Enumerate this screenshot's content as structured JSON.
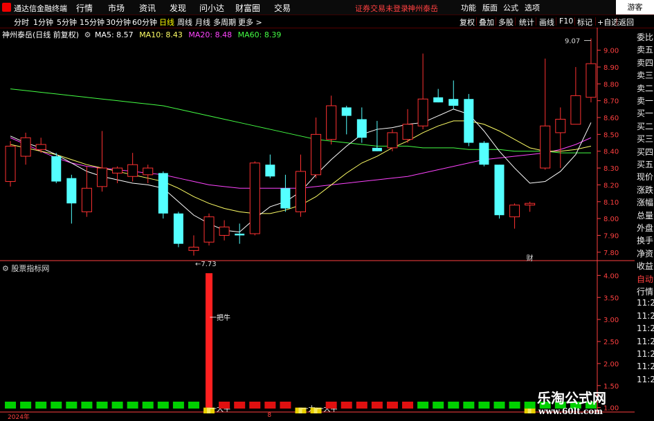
{
  "app": {
    "title": "通达信金融终端"
  },
  "menu": [
    "行情",
    "市场",
    "资讯",
    "发现",
    "问小达",
    "财富圈",
    "交易"
  ],
  "status": {
    "trade": "证券交易未登录",
    "stock": "神州泰岳"
  },
  "right_menu": [
    "功能",
    "版面",
    "公式",
    "选项"
  ],
  "guest": "游客",
  "timeframes": [
    {
      "label": "分时",
      "active": false
    },
    {
      "label": "1分钟",
      "active": false
    },
    {
      "label": "5分钟",
      "active": false
    },
    {
      "label": "15分钟",
      "active": false
    },
    {
      "label": "30分钟",
      "active": false
    },
    {
      "label": "60分钟",
      "active": false
    },
    {
      "label": "日线",
      "active": true
    },
    {
      "label": "周线",
      "active": false
    },
    {
      "label": "月线",
      "active": false
    },
    {
      "label": "多周期",
      "active": false
    },
    {
      "label": "更多 >",
      "active": false
    }
  ],
  "toolbar_right": [
    "复权",
    "叠加",
    "多股",
    "统计",
    "画线",
    "F10",
    "标记",
    "+自选",
    "返回"
  ],
  "info": {
    "stock_label": "神州泰岳(日线 前复权)",
    "ma": [
      {
        "label": "MA5: 8.57",
        "color": "#ffffff"
      },
      {
        "label": "MA10: 8.43",
        "color": "#ffff66"
      },
      {
        "label": "MA20: 8.48",
        "color": "#ff44ff"
      },
      {
        "label": "MA60: 8.39",
        "color": "#44ff44"
      }
    ]
  },
  "side_panel": [
    {
      "label": "委比",
      "hl": false
    },
    {
      "label": "卖五",
      "hl": false
    },
    {
      "label": "卖四",
      "hl": false
    },
    {
      "label": "卖三",
      "hl": false
    },
    {
      "label": "卖二",
      "hl": false
    },
    {
      "label": "卖一",
      "hl": false
    },
    {
      "label": "买一",
      "hl": false
    },
    {
      "label": "买二",
      "hl": false
    },
    {
      "label": "买三",
      "hl": false
    },
    {
      "label": "买四",
      "hl": false
    },
    {
      "label": "买五",
      "hl": false
    },
    {
      "label": "现价",
      "hl": false
    },
    {
      "label": "涨跌",
      "hl": false
    },
    {
      "label": "涨幅",
      "hl": false
    },
    {
      "label": "总量",
      "hl": false
    },
    {
      "label": "外盘",
      "hl": false
    },
    {
      "label": "换手",
      "hl": false
    },
    {
      "label": "净资",
      "hl": false
    },
    {
      "label": "收益",
      "hl": false
    },
    {
      "label": "自动",
      "hl": true
    },
    {
      "label": "行情",
      "hl": false
    },
    {
      "label": "11:2",
      "hl": false
    },
    {
      "label": "11:2",
      "hl": false
    },
    {
      "label": "11:2",
      "hl": false
    },
    {
      "label": "11:2",
      "hl": false
    },
    {
      "label": "11:2",
      "hl": false
    },
    {
      "label": "11:2",
      "hl": false
    },
    {
      "label": "11:2",
      "hl": false
    }
  ],
  "colors": {
    "up": "#ff3232",
    "down": "#54ffff",
    "axis": "#ff4040",
    "ma5": "#ffffff",
    "ma10": "#ffff66",
    "ma20": "#ff44ff",
    "ma60": "#44ff44",
    "gold": "#e8d000"
  },
  "chart_data": {
    "type": "candlestick",
    "price_ticks": [
      "9.00",
      "8.90",
      "8.80",
      "8.70",
      "8.60",
      "8.50",
      "8.40",
      "8.30",
      "8.20",
      "8.10",
      "8.00",
      "7.90",
      "7.80"
    ],
    "ylim": [
      7.75,
      9.06
    ],
    "candles": [
      {
        "o": 8.22,
        "h": 8.46,
        "l": 8.19,
        "c": 8.43
      },
      {
        "o": 8.37,
        "h": 8.51,
        "l": 8.32,
        "c": 8.48
      },
      {
        "o": 8.41,
        "h": 8.48,
        "l": 8.39,
        "c": 8.44
      },
      {
        "o": 8.37,
        "h": 8.39,
        "l": 8.21,
        "c": 8.22
      },
      {
        "o": 8.24,
        "h": 8.26,
        "l": 7.97,
        "c": 8.09
      },
      {
        "o": 8.04,
        "h": 8.31,
        "l": 8.01,
        "c": 8.18
      },
      {
        "o": 8.19,
        "h": 8.52,
        "l": 8.16,
        "c": 8.3
      },
      {
        "o": 8.27,
        "h": 8.31,
        "l": 8.21,
        "c": 8.3
      },
      {
        "o": 8.25,
        "h": 8.39,
        "l": 8.22,
        "c": 8.32
      },
      {
        "o": 8.26,
        "h": 8.32,
        "l": 8.21,
        "c": 8.3
      },
      {
        "o": 8.27,
        "h": 8.28,
        "l": 8.0,
        "c": 8.03
      },
      {
        "o": 8.03,
        "h": 8.04,
        "l": 7.83,
        "c": 7.85
      },
      {
        "o": 7.81,
        "h": 7.9,
        "l": 7.78,
        "c": 7.83
      },
      {
        "o": 7.86,
        "h": 8.03,
        "l": 7.84,
        "c": 8.01
      },
      {
        "o": 7.9,
        "h": 7.99,
        "l": 7.87,
        "c": 7.95
      },
      {
        "o": 7.91,
        "h": 7.97,
        "l": 7.85,
        "c": 7.9
      },
      {
        "o": 7.91,
        "h": 8.34,
        "l": 7.9,
        "c": 8.33
      },
      {
        "o": 8.32,
        "h": 8.38,
        "l": 8.24,
        "c": 8.25
      },
      {
        "o": 8.18,
        "h": 8.26,
        "l": 8.04,
        "c": 8.06
      },
      {
        "o": 8.04,
        "h": 8.38,
        "l": 8.01,
        "c": 8.28
      },
      {
        "o": 8.26,
        "h": 8.6,
        "l": 8.24,
        "c": 8.5
      },
      {
        "o": 8.47,
        "h": 8.73,
        "l": 8.44,
        "c": 8.67
      },
      {
        "o": 8.66,
        "h": 8.67,
        "l": 8.5,
        "c": 8.61
      },
      {
        "o": 8.59,
        "h": 8.66,
        "l": 8.45,
        "c": 8.48
      },
      {
        "o": 8.42,
        "h": 8.58,
        "l": 8.4,
        "c": 8.4
      },
      {
        "o": 8.42,
        "h": 8.53,
        "l": 8.4,
        "c": 8.51
      },
      {
        "o": 8.47,
        "h": 8.65,
        "l": 8.45,
        "c": 8.56
      },
      {
        "o": 8.55,
        "h": 8.98,
        "l": 8.53,
        "c": 8.71
      },
      {
        "o": 8.72,
        "h": 8.77,
        "l": 8.69,
        "c": 8.69
      },
      {
        "o": 8.71,
        "h": 8.82,
        "l": 8.65,
        "c": 8.67
      },
      {
        "o": 8.71,
        "h": 8.74,
        "l": 8.43,
        "c": 8.45
      },
      {
        "o": 8.45,
        "h": 8.46,
        "l": 8.31,
        "c": 8.32
      },
      {
        "o": 8.32,
        "h": 8.32,
        "l": 8.0,
        "c": 8.02
      },
      {
        "o": 8.01,
        "h": 8.09,
        "l": 7.94,
        "c": 8.08
      },
      {
        "o": 8.08,
        "h": 8.1,
        "l": 8.04,
        "c": 8.09
      },
      {
        "o": 8.3,
        "h": 8.95,
        "l": 8.29,
        "c": 8.55
      },
      {
        "o": 8.51,
        "h": 8.66,
        "l": 8.3,
        "c": 8.59
      },
      {
        "o": 8.56,
        "h": 8.9,
        "l": 8.56,
        "c": 8.73
      },
      {
        "o": 8.72,
        "h": 9.07,
        "l": 8.69,
        "c": 8.92
      }
    ],
    "ma5": [
      8.49,
      8.45,
      8.42,
      8.38,
      8.33,
      8.28,
      8.25,
      8.23,
      8.21,
      8.2,
      8.18,
      8.1,
      8.02,
      7.97,
      7.93,
      7.92,
      8.0,
      8.07,
      8.1,
      8.16,
      8.26,
      8.35,
      8.43,
      8.5,
      8.53,
      8.54,
      8.56,
      8.57,
      8.61,
      8.65,
      8.62,
      8.52,
      8.4,
      8.3,
      8.21,
      8.22,
      8.28,
      8.38,
      8.57
    ],
    "ma10": [
      8.44,
      8.42,
      8.4,
      8.38,
      8.35,
      8.32,
      8.3,
      8.28,
      8.26,
      8.24,
      8.22,
      8.18,
      8.13,
      8.09,
      8.06,
      8.04,
      8.03,
      8.03,
      8.05,
      8.08,
      8.13,
      8.2,
      8.27,
      8.33,
      8.37,
      8.42,
      8.46,
      8.51,
      8.55,
      8.58,
      8.58,
      8.56,
      8.52,
      8.47,
      8.42,
      8.4,
      8.4,
      8.41,
      8.43
    ],
    "ma20": [
      8.48,
      8.44,
      8.4,
      8.36,
      8.33,
      8.31,
      8.3,
      8.29,
      8.28,
      8.27,
      8.26,
      8.24,
      8.22,
      8.2,
      8.19,
      8.18,
      8.18,
      8.18,
      8.18,
      8.18,
      8.19,
      8.2,
      8.21,
      8.22,
      8.23,
      8.24,
      8.25,
      8.27,
      8.29,
      8.31,
      8.33,
      8.35,
      8.36,
      8.37,
      8.38,
      8.39,
      8.41,
      8.44,
      8.48
    ],
    "ma60": [
      8.77,
      8.76,
      8.75,
      8.74,
      8.73,
      8.72,
      8.71,
      8.7,
      8.69,
      8.68,
      8.67,
      8.65,
      8.63,
      8.61,
      8.59,
      8.57,
      8.55,
      8.53,
      8.51,
      8.49,
      8.47,
      8.46,
      8.45,
      8.44,
      8.43,
      8.43,
      8.43,
      8.42,
      8.42,
      8.42,
      8.41,
      8.41,
      8.41,
      8.4,
      8.4,
      8.4,
      8.39,
      8.39,
      8.39
    ],
    "annotations": [
      {
        "label": "9.07",
        "index": 38,
        "value": 9.07,
        "side": "left"
      },
      {
        "label": "←7.73",
        "index": 12,
        "value": 7.73,
        "side": "right"
      },
      {
        "label": "财",
        "index": 34,
        "value": 7.75,
        "side": "center"
      }
    ],
    "indicator": {
      "name": "股票指标网",
      "ticks": [
        "4.00",
        "3.50",
        "3.00",
        "2.50",
        "2.00",
        "1.50",
        "1.00"
      ],
      "ylim": [
        0.9,
        4.1
      ],
      "tall_bars": [
        {
          "index": 13,
          "value": 4.05,
          "color": "#ff2020",
          "label": "一把牛",
          "label_value": 3.05
        },
        {
          "index": 13,
          "value": 1.0,
          "color": "#e8d000",
          "label": "一大牛",
          "label_value": 0.98
        },
        {
          "index": 19,
          "value": 1.0,
          "color": "#e8d000",
          "label": "一大",
          "label_value": 0.98
        },
        {
          "index": 20,
          "value": 1.0,
          "color": "#e8d000",
          "label": "一大牛",
          "label_value": 0.98
        },
        {
          "index": 34,
          "value": 1.0,
          "color": "#e8d000",
          "label": "",
          "label_value": 0.98
        }
      ],
      "block_colors": [
        "g",
        "g",
        "g",
        "g",
        "g",
        "g",
        "g",
        "g",
        "g",
        "g",
        "g",
        "g",
        "g",
        "y",
        "r",
        "r",
        "r",
        "r",
        "r",
        "y",
        "y",
        "r",
        "r",
        "r",
        "r",
        "r",
        "r",
        "g",
        "g",
        "g",
        "g",
        "g",
        "g",
        "g",
        "g",
        "g",
        "g",
        "g",
        "g"
      ]
    }
  },
  "date_labels": [
    {
      "label": "2024年",
      "index": 0
    },
    {
      "label": "8",
      "index": 17
    }
  ],
  "watermark": {
    "line1": "乐淘公式网",
    "line2": "www.60lt.com"
  }
}
